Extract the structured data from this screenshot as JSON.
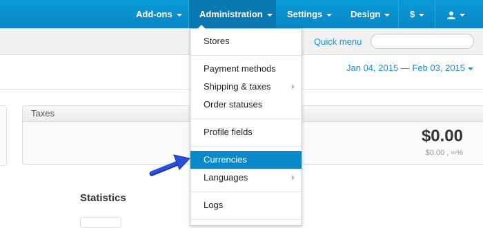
{
  "topnav": {
    "addons": "Add-ons",
    "administration": "Administration",
    "settings": "Settings",
    "design": "Design",
    "currency": "$",
    "user_icon": "user-icon"
  },
  "subbar": {
    "quick_menu": "Quick menu",
    "search_placeholder": ""
  },
  "date_range": "Jan 04, 2015 — Feb 03, 2015",
  "taxes_card": {
    "title": "Taxes",
    "amount": "$0.00",
    "sub": "$0.00 , ∞%"
  },
  "statistics_title": "Statistics",
  "admin_menu": [
    "Stores",
    "Payment methods",
    "Shipping & taxes",
    "Order statuses",
    "Profile fields",
    "Currencies",
    "Languages",
    "Logs"
  ],
  "highlighted_item": "Currencies",
  "colors": {
    "nav_bg": "#0b9ad8",
    "nav_active": "#0a78b3",
    "link": "#1b8fd3",
    "highlight": "#0b88c8",
    "pointer": "#1a3fd6"
  }
}
